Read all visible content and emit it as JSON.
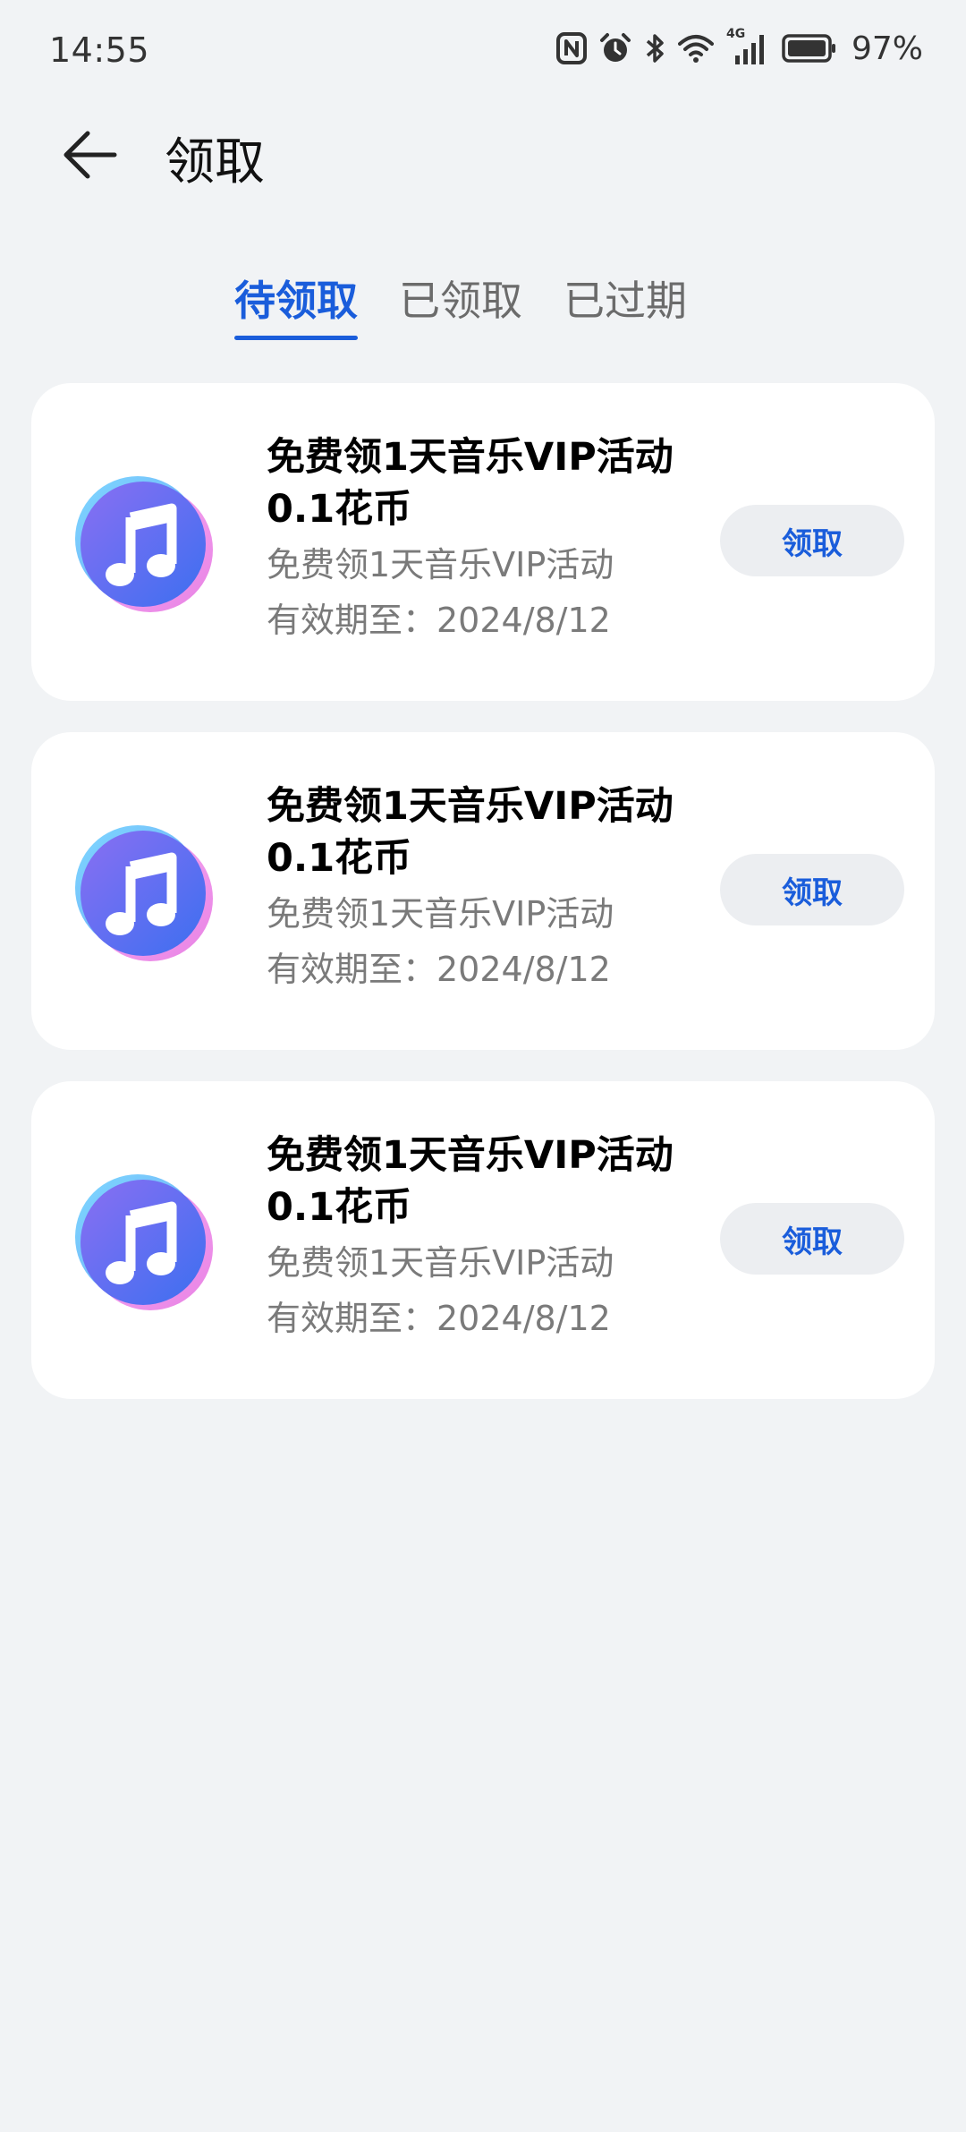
{
  "status_bar": {
    "time": "14:55",
    "battery_percent": "97%",
    "network_label": "4G",
    "icons": [
      "nfc-icon",
      "alarm-icon",
      "bluetooth-icon",
      "wifi-icon",
      "signal-icon",
      "battery-icon"
    ]
  },
  "header": {
    "title": "领取",
    "back_icon": "back-arrow-icon"
  },
  "tabs": [
    {
      "label": "待领取",
      "active": true
    },
    {
      "label": "已领取",
      "active": false
    },
    {
      "label": "已过期",
      "active": false
    }
  ],
  "colors": {
    "accent": "#1a5ddb",
    "background": "#f1f3f5",
    "card": "#ffffff",
    "button_bg": "#eceef1",
    "secondary_text": "#7a7a7a"
  },
  "coupons": [
    {
      "icon": "music-app-icon",
      "title": "免费领1天音乐VIP活动 0.1花币",
      "description": "免费领1天音乐VIP活动",
      "expiry": "有效期至：2024/8/12",
      "button_label": "领取"
    },
    {
      "icon": "music-app-icon",
      "title": "免费领1天音乐VIP活动 0.1花币",
      "description": "免费领1天音乐VIP活动",
      "expiry": "有效期至：2024/8/12",
      "button_label": "领取"
    },
    {
      "icon": "music-app-icon",
      "title": "免费领1天音乐VIP活动 0.1花币",
      "description": "免费领1天音乐VIP活动",
      "expiry": "有效期至：2024/8/12",
      "button_label": "领取"
    }
  ]
}
